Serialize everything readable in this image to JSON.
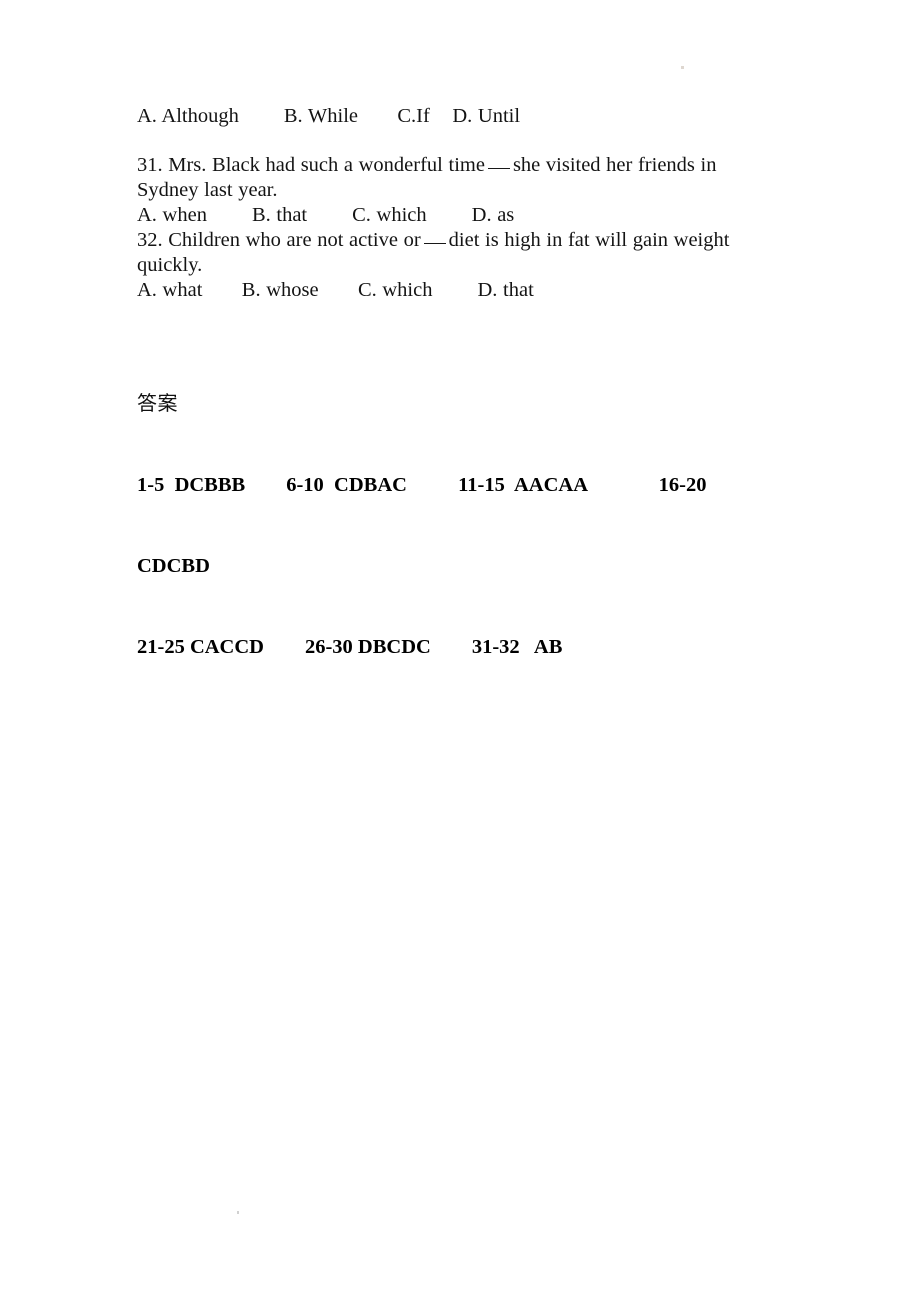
{
  "document": {
    "background_color": "#ffffff",
    "text_color": "#141414"
  },
  "questions": [
    {
      "id": "q30-options",
      "type": "options_only",
      "options_line": "A. Although        B. While       C.If    D. Until"
    },
    {
      "id": "q31",
      "number": "31.",
      "stem_part_1": "31. Mrs. Black had such a wonderful time",
      "stem_part_2": "she visited her friends in",
      "stem_line_2": "Sydney last year.",
      "options_line": "A. when        B. that        C. which        D. as"
    },
    {
      "id": "q32",
      "number": "32.",
      "stem_part_1": "32. Children who are not active or",
      "stem_part_2": "diet is high in fat will gain weight",
      "stem_line_2": "quickly.",
      "options_line": "A. what       B. whose       C. which        D. that"
    }
  ],
  "answer_key": {
    "title": "答案",
    "rows": [
      "1-5  DCBBB        6-10  CDBAC          11-15  AACAA              16-20",
      "CDCBD",
      "21-25 CACCD        26-30 DBCDC        31-32   AB"
    ],
    "ranges": [
      {
        "range": "1-5",
        "answers": "DCBBB"
      },
      {
        "range": "6-10",
        "answers": "CDBAC"
      },
      {
        "range": "11-15",
        "answers": "AACAA"
      },
      {
        "range": "16-20",
        "answers": "CDCBD"
      },
      {
        "range": "21-25",
        "answers": "CACCD"
      },
      {
        "range": "26-30",
        "answers": "DBCDC"
      },
      {
        "range": "31-32",
        "answers": "AB"
      }
    ]
  }
}
